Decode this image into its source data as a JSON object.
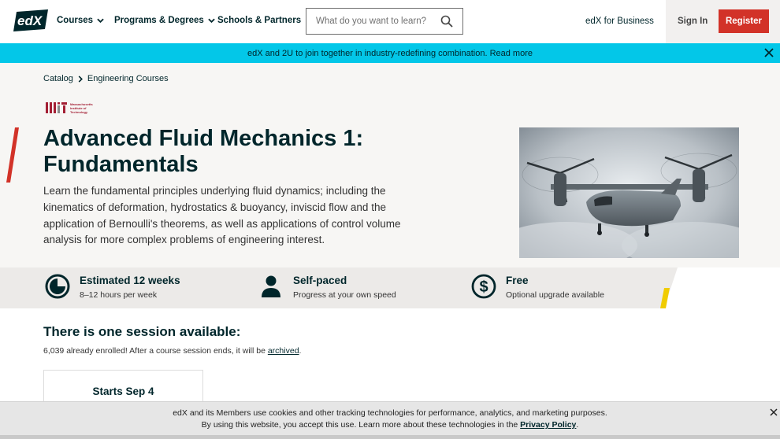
{
  "header": {
    "logo_text": "edX",
    "nav": [
      {
        "label": "Courses"
      },
      {
        "label": "Programs & Degrees"
      },
      {
        "label": "Schools & Partners"
      }
    ],
    "search_placeholder": "What do you want to learn?",
    "business_link": "edX for Business",
    "sign_in": "Sign In",
    "register": "Register"
  },
  "banner": {
    "text": "edX and 2U to join together in industry-redefining combination. Read more"
  },
  "breadcrumb": {
    "items": [
      "Catalog",
      "Engineering Courses"
    ]
  },
  "course": {
    "partner_logo_text": "Massachusetts Institute of Technology",
    "title_line1": "Advanced Fluid Mechanics 1:",
    "title_line2": "Fundamentals",
    "description": "Learn the fundamental principles underlying fluid dynamics; including the kinematics of deformation, hydrostatics & buoyancy, inviscid flow and the application of Bernoulli's theorems, as well as applications of control volume analysis for more complex problems of engineering interest."
  },
  "info": [
    {
      "title": "Estimated 12 weeks",
      "sub": "8–12 hours per week",
      "icon": "clock-icon"
    },
    {
      "title": "Self-paced",
      "sub": "Progress at your own speed",
      "icon": "person-icon"
    },
    {
      "title": "Free",
      "sub": "Optional upgrade available",
      "icon": "dollar-icon"
    }
  ],
  "sessions": {
    "title": "There is one session available:",
    "enrolled_text": "6,039 already enrolled! After a course session ends, it will be",
    "archived_link": "archived",
    "enrolled_suffix": ".",
    "card_label": "Starts Sep 4"
  },
  "cookie": {
    "line1": "edX and its Members use cookies and other tracking technologies for performance, analytics, and marketing purposes.",
    "line2": "By using this website, you accept this use. Learn more about these technologies in the",
    "policy_link": "Privacy Policy",
    "line2_suffix": "."
  },
  "colors": {
    "brand_dark": "#00262b",
    "register_red": "#d23228",
    "banner_cyan": "#03c7e8",
    "accent_yellow": "#f0cc00",
    "mit_red": "#a31f34"
  }
}
